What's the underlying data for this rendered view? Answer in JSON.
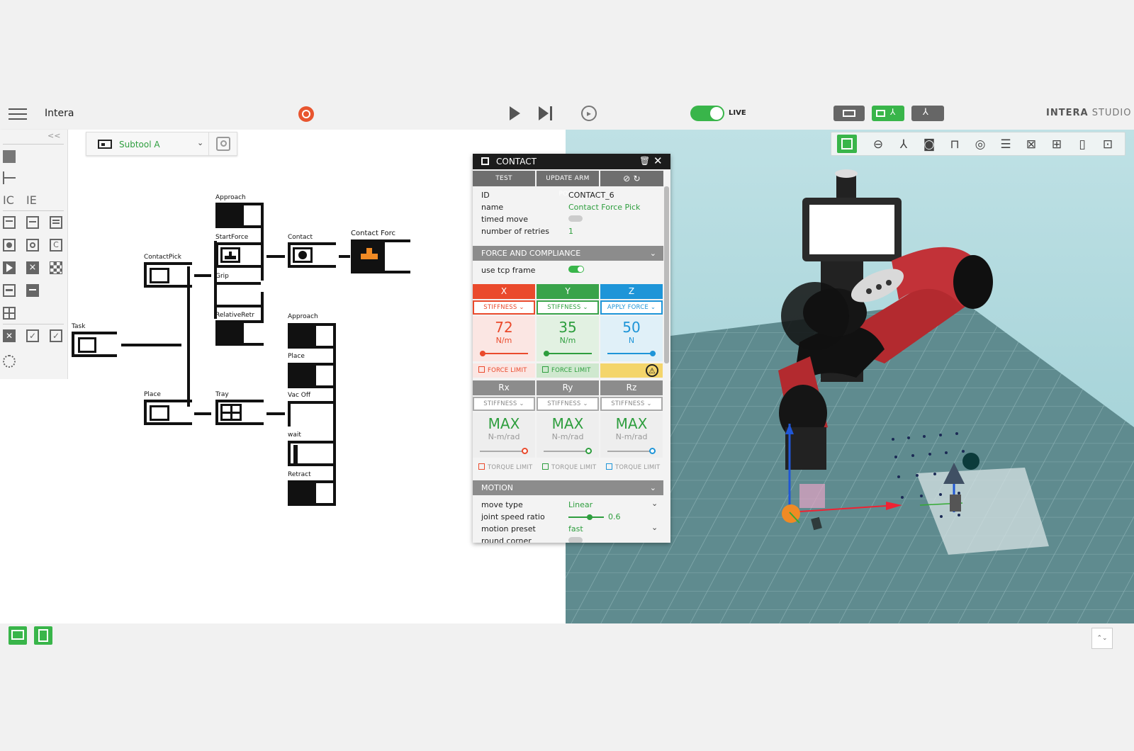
{
  "app": {
    "title": "Intera",
    "brand": "INTERA",
    "brand_sub": "STUDIO",
    "live_label": "LIVE"
  },
  "subtool": {
    "label": "Subtool A"
  },
  "tree": {
    "nodes": {
      "task": "Task",
      "contactpick": "ContactPick",
      "place_root": "Place",
      "approach1": "Approach",
      "startforce": "StartForce",
      "grip": "Grip",
      "relativeretr": "RelativeRetr",
      "contact": "Contact",
      "contactforce": "Contact Forc",
      "tray": "Tray",
      "approach2": "Approach",
      "place2": "Place",
      "vacoff": "Vac Off",
      "wait": "wait",
      "retract": "Retract"
    }
  },
  "contact_panel": {
    "title": "CONTACT",
    "test_label": "TEST",
    "update_label": "UPDATE ARM POSE",
    "props": [
      {
        "key": "ID",
        "value": "CONTACT_6"
      },
      {
        "key": "name",
        "value": "Contact Force Pick"
      },
      {
        "key": "timed move",
        "value": ""
      },
      {
        "key": "number of retries",
        "value": "1"
      }
    ],
    "force_section": "FORCE AND COMPLIANCE",
    "use_tcp_frame": "use tcp frame",
    "axes": [
      {
        "name": "X",
        "mode": "STIFFNESS",
        "value": "72",
        "unit": "N/m",
        "limit": "FORCE LIMIT",
        "color": "#ea4a2c"
      },
      {
        "name": "Y",
        "mode": "STIFFNESS",
        "value": "35",
        "unit": "N/m",
        "limit": "FORCE LIMIT",
        "color": "#2e9e3e"
      },
      {
        "name": "Z",
        "mode": "APPLY FORCE",
        "value": "50",
        "unit": "N",
        "limit": "",
        "color": "#1e95d8"
      }
    ],
    "rot_axes": [
      {
        "name": "Rx",
        "mode": "STIFFNESS",
        "value": "MAX",
        "unit": "N-m/rad",
        "limit": "TORQUE LIMIT"
      },
      {
        "name": "Ry",
        "mode": "STIFFNESS",
        "value": "MAX",
        "unit": "N-m/rad",
        "limit": "TORQUE LIMIT"
      },
      {
        "name": "Rz",
        "mode": "STIFFNESS",
        "value": "MAX",
        "unit": "N-m/rad",
        "limit": "TORQUE LIMIT"
      }
    ],
    "motion_section": "MOTION",
    "motion": [
      {
        "key": "move type",
        "value": "Linear"
      },
      {
        "key": "joint speed ratio",
        "value": "0.6"
      },
      {
        "key": "motion preset",
        "value": "fast"
      },
      {
        "key": "round corner",
        "value": ""
      }
    ]
  },
  "colors": {
    "green": "#39b54a",
    "red": "#ea4a2c",
    "blue": "#1e95d8",
    "yellow": "#f4d56b"
  }
}
